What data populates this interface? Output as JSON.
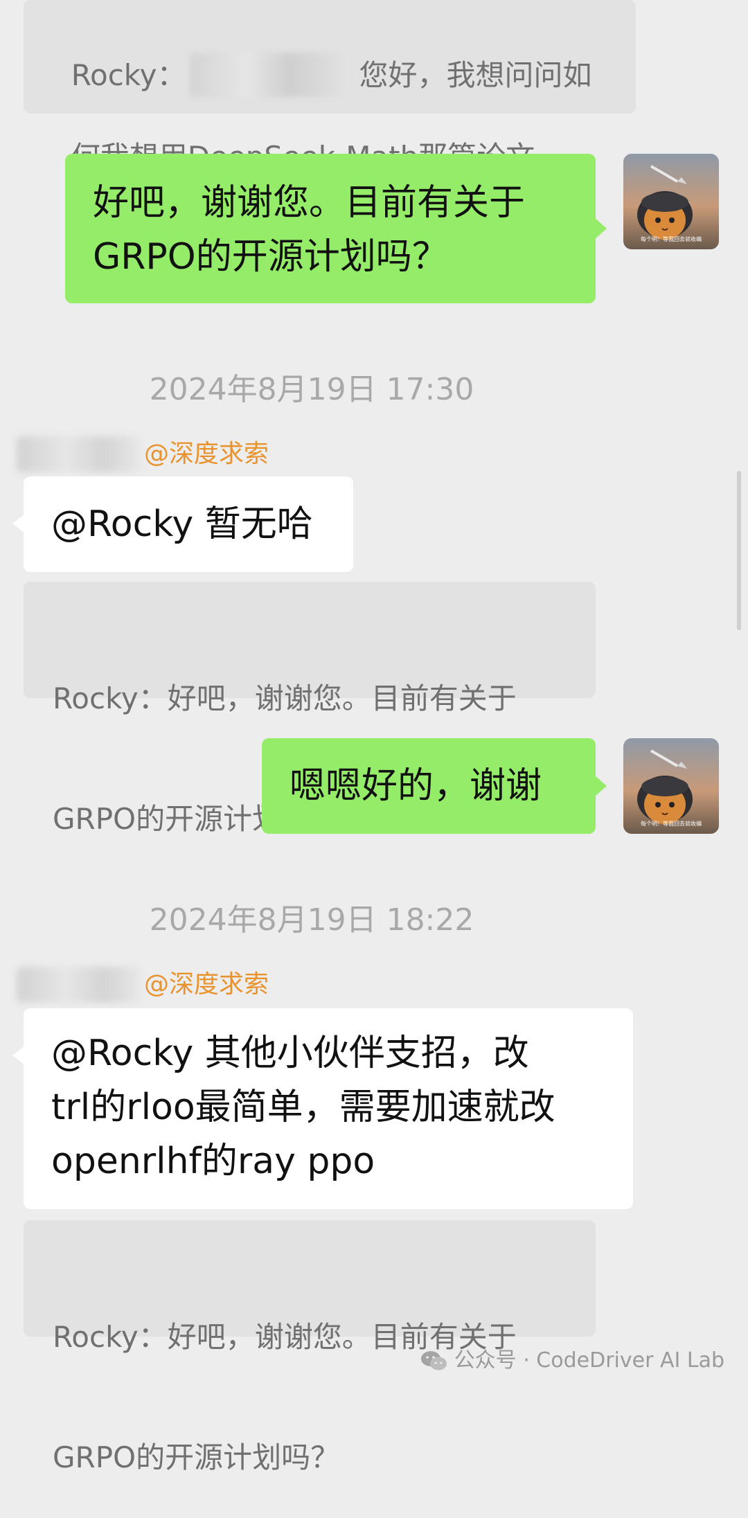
{
  "messages": {
    "quote_top": {
      "prefix": "Rocky：",
      "suffix": "您好，我想问问如",
      "line2": "何我想用DeepSeek-Math那篇论文..."
    },
    "out_1": {
      "line1": "好吧，谢谢您。目前有关于",
      "line2": "GRPO的开源计划吗？"
    },
    "time_1": "2024年8月19日 17:30",
    "sender_1_group": "@深度求索",
    "in_1": "@Rocky 暂无哈",
    "quote_1": {
      "line1": "Rocky：好吧，谢谢您。目前有关于",
      "line2": "GRPO的开源计划吗？"
    },
    "out_2": "嗯嗯好的，谢谢",
    "time_2": "2024年8月19日 18:22",
    "sender_2_group": "@深度求索",
    "in_2": {
      "line1": "@Rocky  其他小伙伴支招，改",
      "line2": "trl的rloo最简单，需要加速就改",
      "line3": "openrlhf的ray ppo"
    },
    "quote_2": {
      "line1": "Rocky：好吧，谢谢您。目前有关于",
      "line2": "GRPO的开源计划吗？"
    }
  },
  "avatar_overlay_text": "每个明！等我回去就收编",
  "watermark": {
    "text": "公众号 · CodeDriver AI Lab",
    "icon": "wechat-icon"
  },
  "colors": {
    "background": "#ededed",
    "outgoing_bubble": "#95ec69",
    "incoming_bubble": "#ffffff",
    "quote_bubble": "#e2e2e2",
    "group_name": "#e9932e",
    "timestamp": "#a8a8a8"
  }
}
